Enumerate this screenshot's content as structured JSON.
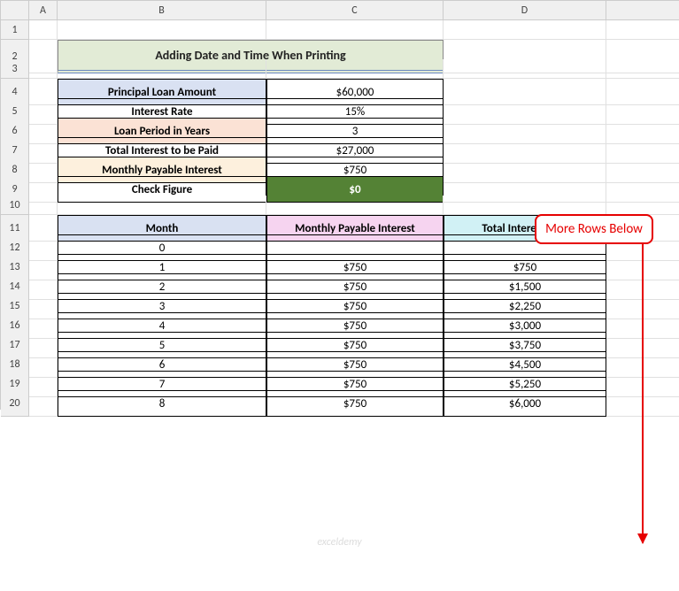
{
  "columns": [
    "",
    "A",
    "B",
    "C",
    "D",
    ""
  ],
  "rows": [
    "1",
    "2",
    "3",
    "4",
    "5",
    "6",
    "7",
    "8",
    "9",
    "10",
    "11",
    "12",
    "13",
    "14",
    "15",
    "16",
    "17",
    "18",
    "19",
    "20"
  ],
  "title": "Adding Date and Time When Printing",
  "summary": [
    {
      "label": "Principal Loan Amount",
      "value": "$60,000",
      "labelClass": "bg-blue"
    },
    {
      "label": "Interest Rate",
      "value": "15%",
      "labelClass": ""
    },
    {
      "label": "Loan Period in Years",
      "value": "3",
      "labelClass": "bg-pink"
    },
    {
      "label": "Total Interest to be Paid",
      "value": "$27,000",
      "labelClass": ""
    },
    {
      "label": "Monthly Payable Interest",
      "value": "$750",
      "labelClass": "bg-cream"
    },
    {
      "label": "Check Figure",
      "value": "$0",
      "labelClass": "",
      "valueClass": "bg-green-dark"
    }
  ],
  "table_headers": {
    "month": "Month",
    "monthly": "Monthly Payable Interest",
    "total": "Total Interest Paid"
  },
  "table_rows": [
    {
      "month": "0",
      "monthly": "",
      "total": ""
    },
    {
      "month": "1",
      "monthly": "$750",
      "total": "$750"
    },
    {
      "month": "2",
      "monthly": "$750",
      "total": "$1,500"
    },
    {
      "month": "3",
      "monthly": "$750",
      "total": "$2,250"
    },
    {
      "month": "4",
      "monthly": "$750",
      "total": "$3,000"
    },
    {
      "month": "5",
      "monthly": "$750",
      "total": "$3,750"
    },
    {
      "month": "6",
      "monthly": "$750",
      "total": "$4,500"
    },
    {
      "month": "7",
      "monthly": "$750",
      "total": "$5,250"
    },
    {
      "month": "8",
      "monthly": "$750",
      "total": "$6,000"
    }
  ],
  "annotation": "More Rows Below",
  "watermark": "exceldemy"
}
